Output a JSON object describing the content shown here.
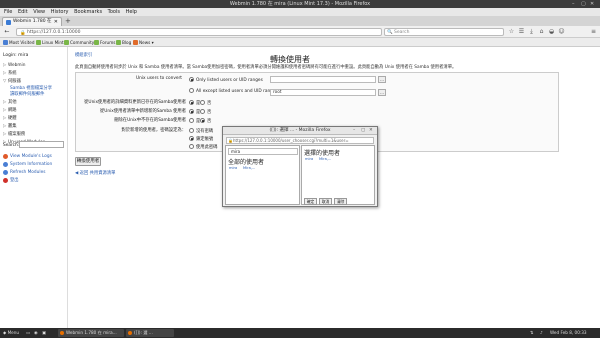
{
  "window": {
    "title": "Webmin 1.780 在 mira (Linux Mint 17.3) - Mozilla Firefox",
    "controls": [
      "–",
      "▢",
      "✕"
    ]
  },
  "menu": [
    "File",
    "Edit",
    "View",
    "History",
    "Bookmarks",
    "Tools",
    "Help"
  ],
  "tab": {
    "label": "Webmin 1.780 在 mira (Li...",
    "close": "✕",
    "new": "+"
  },
  "nav": {
    "url": "https://127.0.0.1:10000",
    "search_placeholder": "Search",
    "back": "←",
    "forward": "→",
    "reload": "↻",
    "go": "→"
  },
  "bookmarks": [
    {
      "label": "Most Visited ▾",
      "color": "#4a7fd4"
    },
    {
      "label": "Linux Mint",
      "color": "#7ab648"
    },
    {
      "label": "Community",
      "color": "#7ab648"
    },
    {
      "label": "Forums",
      "color": "#7ab648"
    },
    {
      "label": "Blog",
      "color": "#7ab648"
    },
    {
      "label": "News ▾",
      "color": "#e06b2a"
    }
  ],
  "sidebar": {
    "login": "Login: mira",
    "items": [
      {
        "label": "Webmin"
      },
      {
        "label": "系統"
      },
      {
        "label": "伺服器"
      }
    ],
    "subitems": [
      {
        "label": "Samba 視窗檔案分享"
      },
      {
        "label": "讀取郵件伺服郵件"
      }
    ],
    "items2": [
      {
        "label": "其他"
      },
      {
        "label": "網路"
      },
      {
        "label": "硬體"
      },
      {
        "label": "叢集"
      },
      {
        "label": "檔案服務"
      },
      {
        "label": "Un-used Modules"
      }
    ],
    "search_label": "Search:",
    "links": [
      {
        "label": "View Module's Logs",
        "color": "#e05a2a"
      },
      {
        "label": "System Information",
        "color": "#4a7fd4"
      },
      {
        "label": "Refresh Modules",
        "color": "#4a7fd4"
      },
      {
        "label": "登出",
        "color": "#d0302a"
      }
    ]
  },
  "main": {
    "module_index": "模組索引",
    "title": "轉換使用者",
    "description": "此頁面自動將使用者同步於 Unix 和 Samba 使用者清單。當 Samba使用加密密碼，使用者清單必須分開維護和使用者密碼將有可能在進行中重設。此頁能自動為 Unix 使用者在 Samba 使用者清單。",
    "form": {
      "unix_users_label": "Unix users to convert",
      "opt_only": "Only listed users or UID ranges",
      "opt_except": "All except listed users and UID ranges",
      "except_value": "root",
      "q1": "從Unix使用者的詳細資料更新已存在的Samba使用者",
      "q2": "從Unix使用者清單中新增新的Samba 使用者",
      "q3": "刪除在Unix中不存在的Samba使用者",
      "q4": "對於新增的使用者，密碼設定為：",
      "yes": "是",
      "no": "否",
      "pw_opts": [
        "沒有密碼",
        "鎖定帳號",
        "使用此密碼"
      ],
      "small_btn": "..."
    },
    "make_button": "轉換使用者",
    "back_link": "返回 共用資源清單"
  },
  "popup": {
    "title": "(⁠[⁠]⁠): 選擇 ... - Mozilla Firefox",
    "url": "https://127.0.0.1:10000/user_chooser.cgi?multi=1&user=",
    "filter": "mira",
    "left_heading": "全部的使用者",
    "right_heading": "選擇的使用者",
    "left_rows": [
      {
        "user": "mira",
        "name": "Mira,..."
      }
    ],
    "right_rows": [
      {
        "user": "mira",
        "name": "Mira,..."
      }
    ],
    "ok": "確定",
    "cancel": "取消",
    "clear": "清除",
    "controls": [
      "–",
      "▢",
      "✕"
    ]
  },
  "taskbar": {
    "menu": "Menu",
    "tasks": [
      "Webmin 1.780 在 mira...",
      "(⁠[⁠]⁠): 選 ..."
    ],
    "clock": "Wed Feb 8, 00:33"
  }
}
